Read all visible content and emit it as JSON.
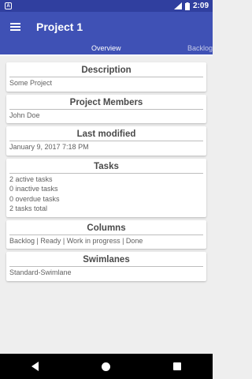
{
  "status_bar": {
    "time": "2:09",
    "notification_icon": "android-notification-icon",
    "signal_icon": "cell-signal-icon",
    "battery_icon": "battery-icon"
  },
  "app_bar": {
    "title": "Project 1",
    "menu_icon": "hamburger-menu-icon"
  },
  "tabs": [
    {
      "label": "Overview",
      "selected": true
    },
    {
      "label": "Backlog",
      "selected": false
    }
  ],
  "cards": {
    "description": {
      "title": "Description",
      "lines": [
        "Some Project"
      ]
    },
    "members": {
      "title": "Project Members",
      "lines": [
        "John Doe"
      ]
    },
    "last_modified": {
      "title": "Last modified",
      "lines": [
        "January 9, 2017 7:18 PM"
      ]
    },
    "tasks": {
      "title": "Tasks",
      "lines": [
        "2 active tasks",
        "0 inactive tasks",
        "0 overdue tasks",
        "2 tasks total"
      ]
    },
    "columns": {
      "title": "Columns",
      "lines": [
        "Backlog | Ready | Work in progress | Done"
      ]
    },
    "swimlanes": {
      "title": "Swimlanes",
      "lines": [
        "Standard-Swimlane"
      ]
    }
  },
  "colors": {
    "primary": "#3f51b5",
    "primary_dark": "#303f9f",
    "background": "#eeeeee"
  }
}
